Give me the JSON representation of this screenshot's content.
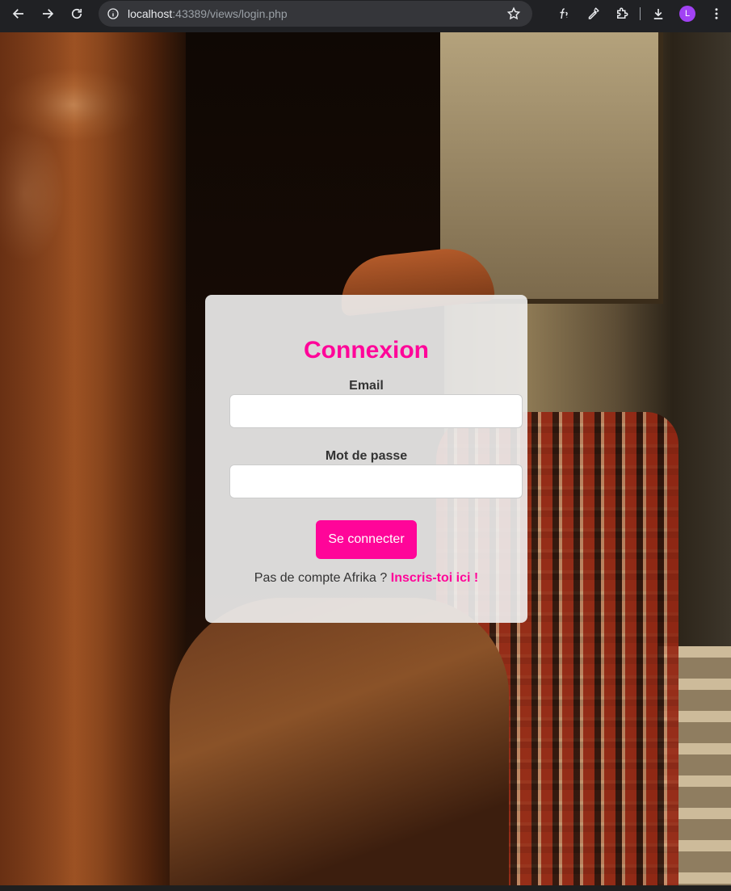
{
  "browser": {
    "url_host": "localhost",
    "url_rest": ":43389/views/login.php",
    "avatar_letter": "L",
    "icons": [
      "back-icon",
      "forward-icon",
      "reload-icon",
      "info-icon",
      "star-icon",
      "function-icon",
      "eyedropper-icon",
      "extensions-icon",
      "download-icon",
      "avatar",
      "more-icon"
    ]
  },
  "login": {
    "title": "Connexion",
    "email_label": "Email",
    "email_value": "",
    "password_label": "Mot de passe",
    "password_value": "",
    "submit_label": "Se connecter",
    "signup_prompt": "Pas de compte Afrika ?",
    "signup_link": "Inscris-toi ici !"
  },
  "colors": {
    "accent": "#ff0599",
    "card": "#f0f0f0",
    "text": "#333333"
  }
}
